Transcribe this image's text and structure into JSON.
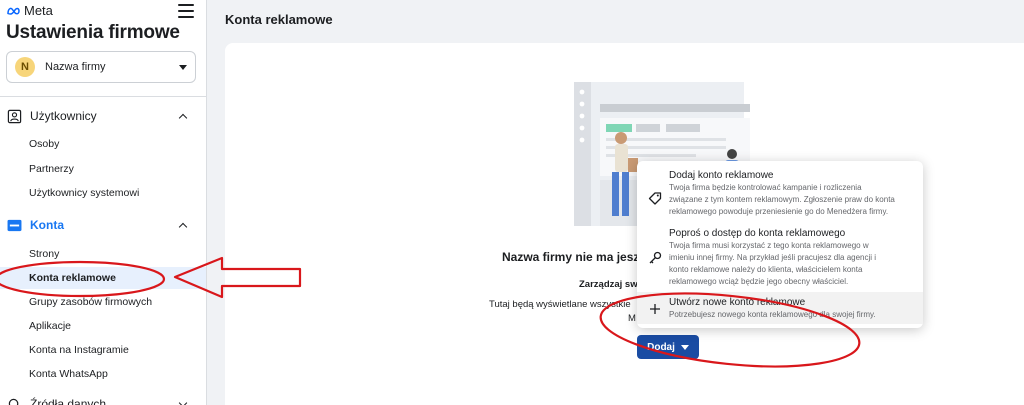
{
  "app": {
    "brand": "Meta",
    "settings_title": "Ustawienia firmowe",
    "business": {
      "initial": "N",
      "name": "Nazwa firmy"
    }
  },
  "sidebar": {
    "sections": [
      {
        "label": "Użytkownicy",
        "expanded": true,
        "icon": "users-icon",
        "items": [
          "Osoby",
          "Partnerzy",
          "Użytkownicy systemowi"
        ]
      },
      {
        "label": "Konta",
        "expanded": true,
        "icon": "folder-icon",
        "accent": "#1877f2",
        "items": [
          "Strony",
          "Konta reklamowe",
          "Grupy zasobów firmowych",
          "Aplikacje",
          "Konta na Instagramie",
          "Konta WhatsApp"
        ],
        "active_item": "Konta reklamowe"
      },
      {
        "label": "Źródła danych",
        "expanded": false,
        "icon": "data-sources-icon"
      }
    ]
  },
  "main": {
    "page_title": "Konta reklamowe",
    "empty_state": {
      "title": "Nazwa firmy nie ma jesz",
      "subtitle": "Zarządzaj sw",
      "description": "Tutaj będą wyświetlane wszystkie",
      "description_line2": "M"
    },
    "add_button_label": "Dodaj"
  },
  "dropdown": {
    "items": [
      {
        "title": "Dodaj konto reklamowe",
        "icon": "tag-icon",
        "description": [
          "Twoja firma będzie kontrolować kampanie i rozliczenia",
          "związane z tym kontem reklamowym. Zgłoszenie praw do konta",
          "reklamowego powoduje przeniesienie go do Menedżera firmy."
        ]
      },
      {
        "title": "Poproś o dostęp do konta reklamowego",
        "icon": "key-icon",
        "description": [
          "Twoja firma musi korzystać z tego konta reklamowego w",
          "imieniu innej firmy. Na przykład jeśli pracujesz dla agencji i",
          "konto reklamowe należy do klienta, właścicielem konta",
          "reklamowego wciąż będzie jego obecny właściciel."
        ]
      },
      {
        "title": "Utwórz nowe konto reklamowe",
        "icon": "plus-icon",
        "highlighted": true,
        "description": [
          "Potrzebujesz nowego konta reklamowego dla swojej firmy."
        ]
      }
    ]
  },
  "colors": {
    "accent": "#1877f2",
    "button": "#1a4ca3",
    "annotation": "#d9171b",
    "active_bg": "#e7f0fd"
  }
}
